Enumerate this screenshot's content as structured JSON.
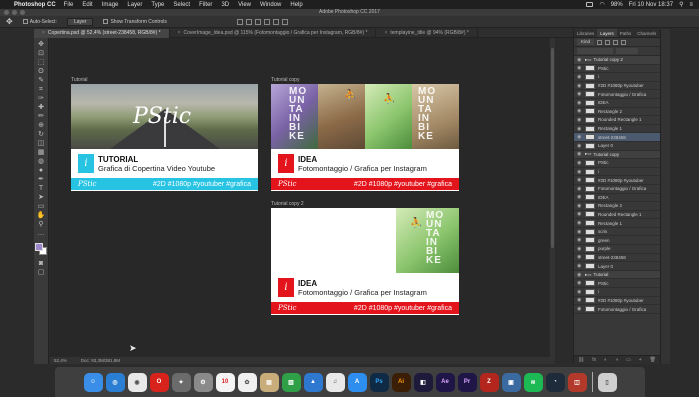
{
  "menubar": {
    "app_name": "Photoshop CC",
    "menus": [
      "File",
      "Edit",
      "Image",
      "Layer",
      "Type",
      "Select",
      "Filter",
      "3D",
      "View",
      "Window",
      "Help"
    ],
    "battery": "98%",
    "datetime": "Fri 10 Nov  18:37"
  },
  "window_title": "Adobe Photoshop CC 2017",
  "options": {
    "auto_select_label": "Auto-Select:",
    "auto_select_value": "Layer",
    "transform_label": "Show Transform Controls"
  },
  "doc_tabs": [
    {
      "label": "Copertina.psd @ 52,4% (street-238458, RGB/8#) *",
      "active": true
    },
    {
      "label": "CoverImage_Idea.psd @ 115% (Fotomontaggio / Grafica per Instagram, RGB/8#) *",
      "active": false
    },
    {
      "label": "templayine_title @ 94% (RGB/8#) *",
      "active": false
    }
  ],
  "tools": [
    "move-tool",
    "artboard-tool",
    "marquee-tool",
    "lasso-tool",
    "quick-select-tool",
    "crop-tool",
    "eyedropper-tool",
    "healing-tool",
    "brush-tool",
    "stamp-tool",
    "history-brush-tool",
    "eraser-tool",
    "gradient-tool",
    "blur-tool",
    "dodge-tool",
    "pen-tool",
    "type-tool",
    "path-select-tool",
    "shape-tool",
    "hand-tool",
    "zoom-tool",
    "more-tool"
  ],
  "tool_glyphs": [
    "✥",
    "⊡",
    "⬚",
    "ʘ",
    "✎",
    "⌗",
    "✑",
    "✚",
    "✏",
    "⊕",
    "↻",
    "◫",
    "▦",
    "◍",
    "●",
    "✒",
    "T",
    "➤",
    "▭",
    "✋",
    "⚲",
    "…"
  ],
  "colors": {
    "foreground": "#9a86c8",
    "background": "#ffffff",
    "cyan": "#27c3e3",
    "red": "#e3141b"
  },
  "artboards": {
    "tutorial": {
      "label": "Tutorial",
      "logo": "PStic",
      "heading": "TUTORIAL",
      "subheading": "Grafica di Copertina Video Youtube",
      "brand": "PStic",
      "tags": "#2D #1080p #youtuber #grafica"
    },
    "tutorial_copy": {
      "label": "Tutorial copy",
      "mtb_text": [
        "MO",
        "UN",
        "TA",
        "IN",
        "BI",
        "KE"
      ],
      "heading": "IDEA",
      "subheading": "Fotomontaggio / Grafica per Instagram",
      "brand": "PStic",
      "tags": "#2D #1080p #youtuber #grafica"
    },
    "tutorial_copy_2": {
      "label": "Tutorial copy 2",
      "mtb_text": [
        "MO",
        "UN",
        "TA",
        "IN",
        "BI",
        "KE"
      ],
      "heading": "IDEA",
      "subheading": "Fotomontaggio / Grafica per Instagram",
      "brand": "PStic",
      "tags": "#2D #1080p #youtuber #grafica"
    }
  },
  "panels": {
    "tabs": [
      "Libraries",
      "Layers",
      "Paths",
      "Channels"
    ],
    "active_tab": "Layers",
    "kind_label": "Kind",
    "layers": [
      {
        "name": "Tutorial copy 2",
        "type": "group"
      },
      {
        "name": "PStic",
        "type": "layer"
      },
      {
        "name": "i",
        "type": "layer"
      },
      {
        "name": "#2D #1080p #youtuber",
        "type": "layer"
      },
      {
        "name": "Fotomontaggio / Grafica",
        "type": "layer"
      },
      {
        "name": "IDEA",
        "type": "layer"
      },
      {
        "name": "Rectangle 2",
        "type": "layer"
      },
      {
        "name": "Rounded Rectangle 1",
        "type": "layer"
      },
      {
        "name": "Rectangle 1",
        "type": "layer"
      },
      {
        "name": "street-238458",
        "type": "layer"
      },
      {
        "name": "Layer 0",
        "type": "layer"
      },
      {
        "name": "Tutorial copy",
        "type": "group"
      },
      {
        "name": "PStic",
        "type": "layer"
      },
      {
        "name": "i",
        "type": "layer"
      },
      {
        "name": "#2D #1080p #youtuber",
        "type": "layer"
      },
      {
        "name": "Fotomontaggio / Grafica",
        "type": "layer"
      },
      {
        "name": "IDEA",
        "type": "layer"
      },
      {
        "name": "Rectangle 2",
        "type": "layer"
      },
      {
        "name": "Rounded Rectangle 1",
        "type": "layer"
      },
      {
        "name": "Rectangle 1",
        "type": "layer"
      },
      {
        "name": "scris",
        "type": "layer"
      },
      {
        "name": "green",
        "type": "layer"
      },
      {
        "name": "purple",
        "type": "layer"
      },
      {
        "name": "street-238458",
        "type": "layer"
      },
      {
        "name": "Layer 0",
        "type": "layer"
      },
      {
        "name": "Tutorial",
        "type": "group"
      },
      {
        "name": "PStic",
        "type": "layer"
      },
      {
        "name": "i",
        "type": "layer"
      },
      {
        "name": "#2D #1080p #youtuber",
        "type": "layer"
      },
      {
        "name": "Fotomontaggio / Grafica",
        "type": "layer"
      }
    ]
  },
  "status": {
    "zoom": "52,4%",
    "doc_size": "Doc: 93,3M/381,8M"
  },
  "dock": [
    {
      "name": "finder",
      "label": "",
      "color": "#3b8ee8"
    },
    {
      "name": "safari",
      "label": "",
      "color": "#2a7fd5"
    },
    {
      "name": "chrome",
      "label": "",
      "color": "#e9e9e9"
    },
    {
      "name": "opera",
      "label": "",
      "color": "#d8231c"
    },
    {
      "name": "launchpad",
      "label": "",
      "color": "#6b6b6b"
    },
    {
      "name": "system-preferences",
      "label": "",
      "color": "#8a8a8a"
    },
    {
      "name": "calendar",
      "label": "10",
      "color": "#f5f5f5"
    },
    {
      "name": "photos",
      "label": "",
      "color": "#f0f0f0"
    },
    {
      "name": "preview",
      "label": "",
      "color": "#c8ad7a"
    },
    {
      "name": "numbers",
      "label": "",
      "color": "#2fa048"
    },
    {
      "name": "keynote",
      "label": "",
      "color": "#2f78d0"
    },
    {
      "name": "itunes",
      "label": "",
      "color": "#e9e9e9"
    },
    {
      "name": "app-store",
      "label": "",
      "color": "#2d8ef0"
    },
    {
      "name": "photoshop",
      "label": "Ps",
      "color": "#0e2a45"
    },
    {
      "name": "illustrator",
      "label": "Ai",
      "color": "#3a1f06"
    },
    {
      "name": "premiere-media",
      "label": "",
      "color": "#1d1a3b"
    },
    {
      "name": "after-effects",
      "label": "Ae",
      "color": "#1f1547"
    },
    {
      "name": "premiere",
      "label": "Pr",
      "color": "#1f1547"
    },
    {
      "name": "filezilla",
      "label": "",
      "color": "#b3261e"
    },
    {
      "name": "virtualbox",
      "label": "",
      "color": "#3a6aa0"
    },
    {
      "name": "spotify",
      "label": "",
      "color": "#1db954"
    },
    {
      "name": "speedtest",
      "label": "",
      "color": "#1e2b3a"
    },
    {
      "name": "photo-booth",
      "label": "",
      "color": "#b33a2a"
    },
    {
      "name": "trash",
      "label": "",
      "color": "#cfcfcf"
    }
  ],
  "dock_glyphs": {
    "finder": "☺",
    "safari": "◎",
    "chrome": "◉",
    "opera": "O",
    "launchpad": "✦",
    "system-preferences": "⚙",
    "photos": "✿",
    "preview": "▤",
    "numbers": "▥",
    "keynote": "▲",
    "itunes": "♫",
    "app-store": "A",
    "premiere-media": "◧",
    "filezilla": "Z",
    "virtualbox": "▣",
    "spotify": "≋",
    "speedtest": "◔",
    "photo-booth": "◫",
    "trash": "▯"
  }
}
